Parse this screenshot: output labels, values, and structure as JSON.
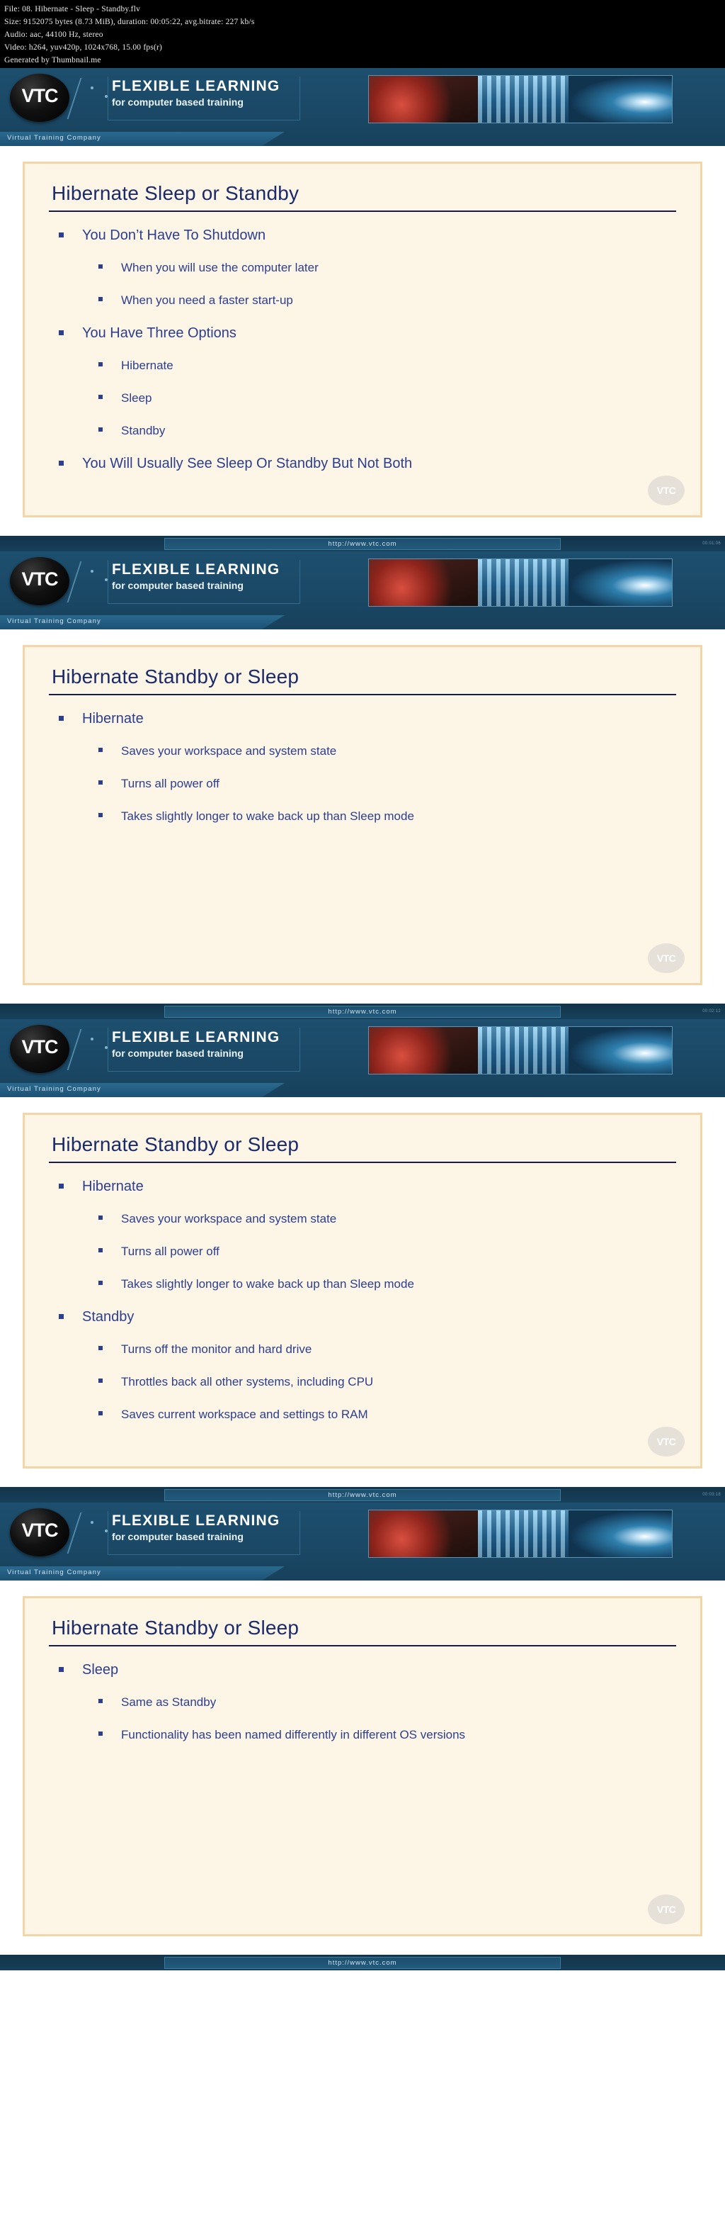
{
  "meta": {
    "lines": [
      "File: 08. Hibernate - Sleep - Standby.flv",
      "Size: 9152075 bytes (8.73 MiB), duration: 00:05:22, avg.bitrate: 227 kb/s",
      "Audio: aac, 44100 Hz, stereo",
      "Video: h264, yuv420p, 1024x768, 15.00 fps(r)",
      "Generated by Thumbnail.me"
    ]
  },
  "banner": {
    "logo_text": "VTC",
    "brand_main": "FLEXIBLE LEARNING",
    "brand_sub": "for computer based training",
    "company_strip": "Virtual Training Company",
    "url": "http://www.vtc.com",
    "watermark": "VTC"
  },
  "slides": [
    {
      "title": "Hibernate Sleep or Standby",
      "timecode": "",
      "has_url": false,
      "bullets": [
        {
          "level": 1,
          "text": "You Don’t Have To Shutdown"
        },
        {
          "level": 2,
          "text": "When you will use the computer later"
        },
        {
          "level": 2,
          "text": "When you need a faster start-up"
        },
        {
          "level": 1,
          "text": "You Have Three Options"
        },
        {
          "level": 2,
          "text": "Hibernate"
        },
        {
          "level": 2,
          "text": "Sleep"
        },
        {
          "level": 2,
          "text": "Standby"
        },
        {
          "level": 1,
          "text": "You Will Usually See Sleep Or Standby But Not Both"
        }
      ]
    },
    {
      "title": "Hibernate Standby or Sleep",
      "timecode": "00:01:06",
      "has_url": true,
      "bullets": [
        {
          "level": 1,
          "text": "Hibernate"
        },
        {
          "level": 2,
          "text": "Saves your workspace and system state"
        },
        {
          "level": 2,
          "text": "Turns all power off"
        },
        {
          "level": 2,
          "text": "Takes slightly longer to wake back up than Sleep mode"
        }
      ]
    },
    {
      "title": "Hibernate Standby or Sleep",
      "timecode": "00:02:12",
      "has_url": true,
      "bullets": [
        {
          "level": 1,
          "text": "Hibernate"
        },
        {
          "level": 2,
          "text": "Saves your workspace and system state"
        },
        {
          "level": 2,
          "text": "Turns all power off"
        },
        {
          "level": 2,
          "text": "Takes slightly longer to wake back up than Sleep mode"
        },
        {
          "level": 1,
          "text": "Standby"
        },
        {
          "level": 2,
          "text": "Turns off the monitor and hard drive"
        },
        {
          "level": 2,
          "text": "Throttles back all other systems, including CPU"
        },
        {
          "level": 2,
          "text": "Saves current workspace and settings to RAM"
        }
      ]
    },
    {
      "title": "Hibernate Standby or Sleep",
      "timecode": "00:03:18",
      "has_url": true,
      "bullets": [
        {
          "level": 1,
          "text": "Sleep"
        },
        {
          "level": 2,
          "text": "Same as Standby"
        },
        {
          "level": 2,
          "text": "Functionality has been named differently in different OS versions"
        }
      ]
    }
  ],
  "footer": {
    "url": "http://www.vtc.com"
  },
  "colors": {
    "banner_blue": "#1d4f6e",
    "slide_bg": "#fdf5e6",
    "slide_border": "#f3d6a8",
    "text_blue": "#2c3e8f",
    "title_blue": "#1b2a6b"
  }
}
